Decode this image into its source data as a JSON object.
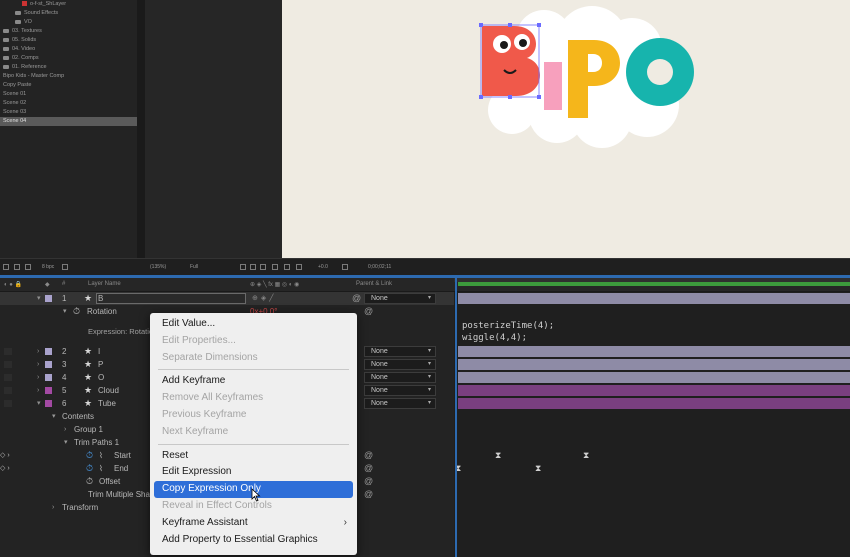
{
  "project": {
    "items": [
      {
        "label": "o-f-st_ShLayer",
        "type": "comp"
      },
      {
        "label": "Sound Effects",
        "type": "folder"
      },
      {
        "label": "VO",
        "type": "folder"
      },
      {
        "label": "03. Textures",
        "type": "folder"
      },
      {
        "label": "05. Solids",
        "type": "folder"
      },
      {
        "label": "04. Video",
        "type": "folder"
      },
      {
        "label": "02. Comps",
        "type": "folder"
      },
      {
        "label": "01. Reference",
        "type": "folder"
      },
      {
        "label": "Bipo Kids - Master Comp",
        "type": "item"
      },
      {
        "label": "Copy Paste",
        "type": "item"
      },
      {
        "label": "Scene 01",
        "type": "item"
      },
      {
        "label": "Scene 02",
        "type": "item"
      },
      {
        "label": "Scene 03",
        "type": "item"
      },
      {
        "label": "Scene 04",
        "type": "item",
        "selected": true
      }
    ]
  },
  "viewer_bar": {
    "bpc": "8 bpc",
    "zoom": "(135%)",
    "resolution": "Full",
    "exposure": "+0.0",
    "timecode": "0;00;02;11"
  },
  "timeline_header": {
    "layer_name": "Layer Name",
    "parent_link": "Parent & Link"
  },
  "layers": [
    {
      "num": "1",
      "name": "B",
      "color": "#a9a2cc",
      "parent": "None",
      "selected": true
    },
    {
      "num": "2",
      "name": "I",
      "color": "#a9a2cc",
      "parent": "None"
    },
    {
      "num": "3",
      "name": "P",
      "color": "#a9a2cc",
      "parent": "None"
    },
    {
      "num": "4",
      "name": "O",
      "color": "#a9a2cc",
      "parent": "None"
    },
    {
      "num": "5",
      "name": "Cloud",
      "color": "#a34aa3",
      "parent": "None"
    },
    {
      "num": "6",
      "name": "Tube",
      "color": "#a34aa3",
      "parent": "None"
    }
  ],
  "properties": {
    "rotation_label": "Rotation",
    "rotation_value": "0x+0.0°",
    "expression_label": "Expression: Rotation",
    "contents": "Contents",
    "group": "Group 1",
    "trim_paths": "Trim Paths 1",
    "start": "Start",
    "end": "End",
    "offset": "Offset",
    "trim_multiple": "Trim Multiple Shapes",
    "transform": "Transform"
  },
  "expression_code": [
    "posterizeTime(4);",
    "wiggle(4,4);"
  ],
  "context_menu": {
    "items": [
      {
        "label": "Edit Value...",
        "enabled": true
      },
      {
        "label": "Edit Properties...",
        "enabled": false
      },
      {
        "label": "Separate Dimensions",
        "enabled": false
      },
      {
        "sep": true
      },
      {
        "label": "Add Keyframe",
        "enabled": true
      },
      {
        "label": "Remove All Keyframes",
        "enabled": false
      },
      {
        "label": "Previous Keyframe",
        "enabled": false
      },
      {
        "label": "Next Keyframe",
        "enabled": false
      },
      {
        "sep": true
      },
      {
        "label": "Reset",
        "enabled": true
      },
      {
        "label": "Edit Expression",
        "enabled": true
      },
      {
        "label": "Copy Expression Only",
        "enabled": true,
        "highlighted": true
      },
      {
        "label": "Reveal in Effect Controls",
        "enabled": false
      },
      {
        "label": "Keyframe Assistant",
        "enabled": true,
        "submenu": true
      },
      {
        "label": "Add Property to Essential Graphics",
        "enabled": true
      }
    ]
  },
  "artwork": {
    "letters": [
      "B",
      "I",
      "P",
      "O"
    ],
    "colors": {
      "b": "#f0594a",
      "i": "#f7a0bd",
      "p": "#f5b61b",
      "o": "#17b4ad",
      "cloud": "#ffffff",
      "bg": "#efebe2"
    }
  }
}
